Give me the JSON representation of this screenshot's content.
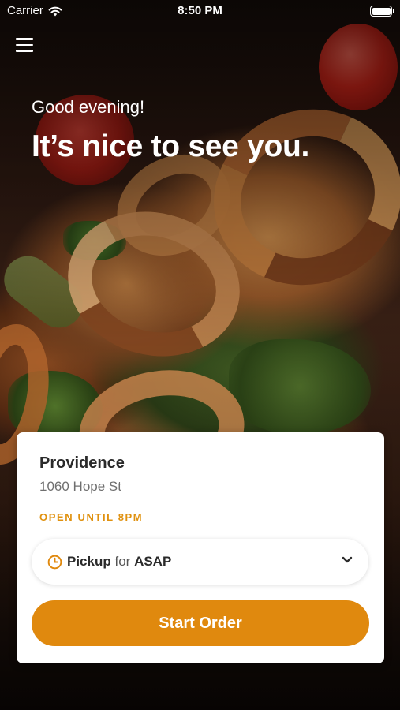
{
  "status_bar": {
    "carrier": "Carrier",
    "time": "8:50 PM",
    "battery_level": 1.0
  },
  "hero": {
    "greeting": "Good evening!",
    "headline": "It’s nice to see you.",
    "background": "photo of grilled shrimp on greens"
  },
  "menu": {
    "icon": "hamburger-menu-icon"
  },
  "location_card": {
    "name": "Providence",
    "address": "1060 Hope St",
    "hours": "OPEN UNTIL 8PM",
    "order_mode": {
      "icon": "clock-icon",
      "mode": "Pickup",
      "connector": "for",
      "time": "ASAP",
      "dropdown_icon": "chevron-down-icon"
    },
    "start_button": "Start Order"
  },
  "colors": {
    "accent": "#e0890e",
    "hours_text": "#e0910f",
    "card_bg": "#ffffff"
  }
}
